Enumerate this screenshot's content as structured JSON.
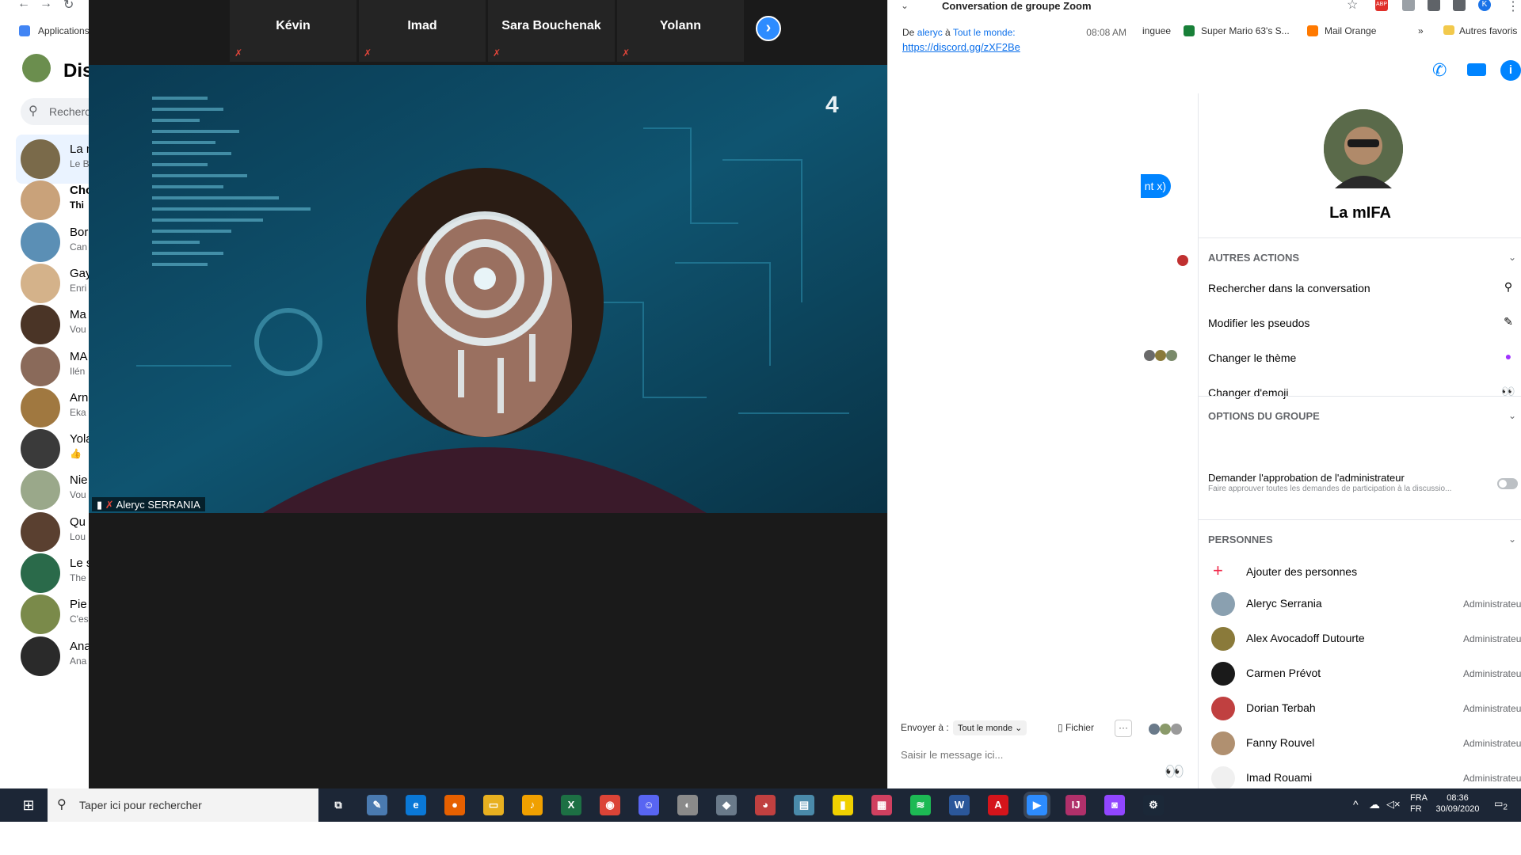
{
  "browser": {
    "bookmarks": [
      {
        "label": "Applications"
      },
      {
        "label": "inguee"
      },
      {
        "label": "Super Mario 63's S..."
      },
      {
        "label": "Mail Orange"
      },
      {
        "label": "Autres favoris"
      }
    ],
    "more_bookmarks": "»",
    "ext_abp": "ABP",
    "profile_initial": "K"
  },
  "messenger": {
    "title": "Dis",
    "search_placeholder": "Recherch",
    "conversations": [
      {
        "name": "La m",
        "sub": "Le B",
        "color": "#7a6a4a",
        "active": true
      },
      {
        "name": "Cho",
        "sub": "Thi",
        "color": "#c9a27a",
        "bold": true
      },
      {
        "name": "Bor",
        "sub": "Can",
        "color": "#5b8fb5"
      },
      {
        "name": "Gay",
        "sub": "Enri",
        "color": "#d4b28a"
      },
      {
        "name": "Ma",
        "sub": "Vou",
        "color": "#4a3426"
      },
      {
        "name": "MA",
        "sub": "Ilén",
        "color": "#8a6a5a"
      },
      {
        "name": "Arn",
        "sub": "Eka",
        "color": "#a07840"
      },
      {
        "name": "Yola",
        "sub": "",
        "color": "#3a3a3a",
        "like_icon": true
      },
      {
        "name": "Nie",
        "sub": "Vou",
        "color": "#9aa88a"
      },
      {
        "name": "Qu",
        "sub": "Lou",
        "color": "#5a4030"
      },
      {
        "name": "Le s",
        "sub": "The",
        "color": "#2a6a4a"
      },
      {
        "name": "Pie",
        "sub": "C'es",
        "color": "#7a8a4a"
      },
      {
        "name": "Ana",
        "sub": "Ana",
        "color": "#2a2a2a"
      }
    ],
    "partial_bubble": "nt x)",
    "group": {
      "name": "La mIFA",
      "sections": {
        "actions_title": "AUTRES ACTIONS",
        "actions": [
          {
            "label": "Rechercher dans la conversation",
            "icon": "search-icon",
            "glyph": "⚲"
          },
          {
            "label": "Modifier les pseudos",
            "icon": "pencil-icon",
            "glyph": "✎"
          },
          {
            "label": "Changer le thème",
            "icon": "theme-icon",
            "glyph": "●"
          },
          {
            "label": "Changer d'emoji",
            "icon": "eyes-emoji-icon",
            "glyph": "👀"
          }
        ],
        "options_title": "OPTIONS DU GROUPE",
        "approval_label": "Demander l'approbation de l'administrateur",
        "approval_sub": "Faire approuver toutes les demandes de participation à la discussio...",
        "approval_on": false,
        "people_title": "PERSONNES",
        "add_people": "Ajouter des personnes",
        "people": [
          {
            "name": "Aleryc Serrania",
            "role": "Administrateu",
            "color": "#8aa0b0"
          },
          {
            "name": "Alex Avocadoff Dutourte",
            "role": "Administrateu",
            "color": "#8a7a3a"
          },
          {
            "name": "Carmen Prévot",
            "role": "Administrateu",
            "color": "#1a1a1a"
          },
          {
            "name": "Dorian Terbah",
            "role": "Administrateu",
            "color": "#c04040"
          },
          {
            "name": "Fanny Rouvel",
            "role": "Administrateu",
            "color": "#b09070"
          },
          {
            "name": "Imad Rouami",
            "role": "Administrateu",
            "color": "#f0f0f0"
          }
        ]
      }
    }
  },
  "zoom": {
    "participants": [
      {
        "name": "Kévin"
      },
      {
        "name": "Imad"
      },
      {
        "name": "Sara Bouchenak"
      },
      {
        "name": "Yolann"
      }
    ],
    "speaker_label": "Aleryc SERRANIA",
    "chat": {
      "title": "Conversation de groupe Zoom",
      "from_prefix": "De",
      "sender": "aleryc",
      "to_word": "à",
      "recipient": "Tout le monde:",
      "time": "08:08 AM",
      "link": "https://discord.gg/zXF2Be",
      "send_to_label": "Envoyer à :",
      "send_to_value": "Tout le monde",
      "file_label": "Fichier",
      "more_label": "···",
      "input_placeholder": "Saisir le message ici..."
    }
  },
  "taskbar": {
    "search_text": "Taper ici pour rechercher",
    "lang_top": "FRA",
    "lang_bottom": "FR",
    "time": "08:36",
    "date": "30/09/2020",
    "notif_count": "2",
    "apps": [
      {
        "name": "task-view-icon",
        "glyph": "⧉",
        "color": "transparent"
      },
      {
        "name": "paint-icon",
        "glyph": "✎",
        "color": "#4a7ab0"
      },
      {
        "name": "edge-icon",
        "glyph": "e",
        "color": "#0a78d7"
      },
      {
        "name": "firefox-icon",
        "glyph": "●",
        "color": "#e66000"
      },
      {
        "name": "file-explorer-icon",
        "glyph": "▭",
        "color": "#e8b020"
      },
      {
        "name": "fl-studio-icon",
        "glyph": "♪",
        "color": "#f0a000"
      },
      {
        "name": "excel-icon",
        "glyph": "X",
        "color": "#1d7044"
      },
      {
        "name": "chrome-icon",
        "glyph": "◉",
        "color": "#db4437"
      },
      {
        "name": "discord-icon",
        "glyph": "☺",
        "color": "#5865f2"
      },
      {
        "name": "app-icon",
        "glyph": "◐",
        "color": "#8a8a8a"
      },
      {
        "name": "app-icon",
        "glyph": "◆",
        "color": "#6a7a8a"
      },
      {
        "name": "paint3d-icon",
        "glyph": "◕",
        "color": "#c04040"
      },
      {
        "name": "notepad-icon",
        "glyph": "▤",
        "color": "#4a8aaa"
      },
      {
        "name": "sticky-notes-icon",
        "glyph": "▮",
        "color": "#f0d000"
      },
      {
        "name": "calculator-icon",
        "glyph": "▦",
        "color": "#d04060"
      },
      {
        "name": "spotify-icon",
        "glyph": "≋",
        "color": "#1db954"
      },
      {
        "name": "word-icon",
        "glyph": "W",
        "color": "#2b579a"
      },
      {
        "name": "acrobat-icon",
        "glyph": "A",
        "color": "#d4141b"
      },
      {
        "name": "zoom-icon",
        "glyph": "▶",
        "color": "#2d8cff"
      },
      {
        "name": "intellij-icon",
        "glyph": "IJ",
        "color": "#b0306a"
      },
      {
        "name": "twitch-icon",
        "glyph": "◙",
        "color": "#9146ff"
      },
      {
        "name": "steam-icon",
        "glyph": "⚙",
        "color": "#1b2838"
      }
    ]
  }
}
